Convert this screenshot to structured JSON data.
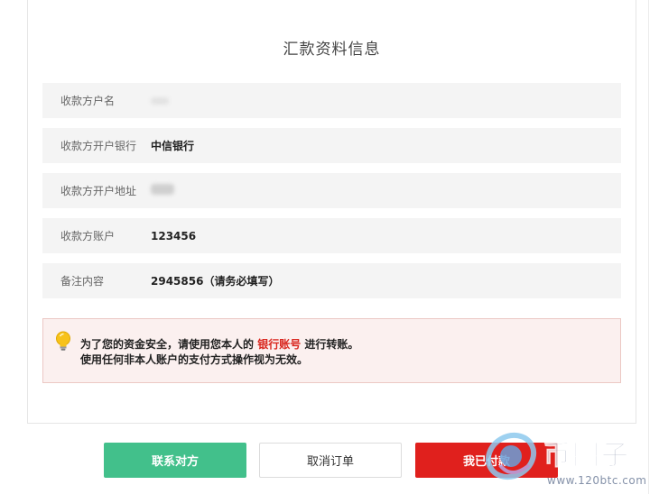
{
  "section_title": "汇款资料信息",
  "fields": [
    {
      "label": "收款方户名",
      "value": ""
    },
    {
      "label": "收款方开户银行",
      "value": "中信银行"
    },
    {
      "label": "收款方开户地址",
      "value": ""
    },
    {
      "label": "收款方账户",
      "value": "123456"
    },
    {
      "label": "备注内容",
      "value": "2945856（请务必填写）"
    }
  ],
  "notice": {
    "icon": "lightbulb-icon",
    "text_before": "为了您的资金安全，请使用您本人的",
    "highlight": "银行账号",
    "text_after": "进行转账。",
    "line2": "使用任何非本人账户的支付方式操作视为无效。",
    "highlight_color": "#d9251d"
  },
  "buttons": {
    "contact": "联系对方",
    "cancel": "取消订单",
    "paid": "我已付款"
  },
  "colors": {
    "contact_green": "#42c08b",
    "paid_red": "#e0201d"
  },
  "watermark": {
    "text": "币圈子",
    "url": "www.120btc.com"
  }
}
